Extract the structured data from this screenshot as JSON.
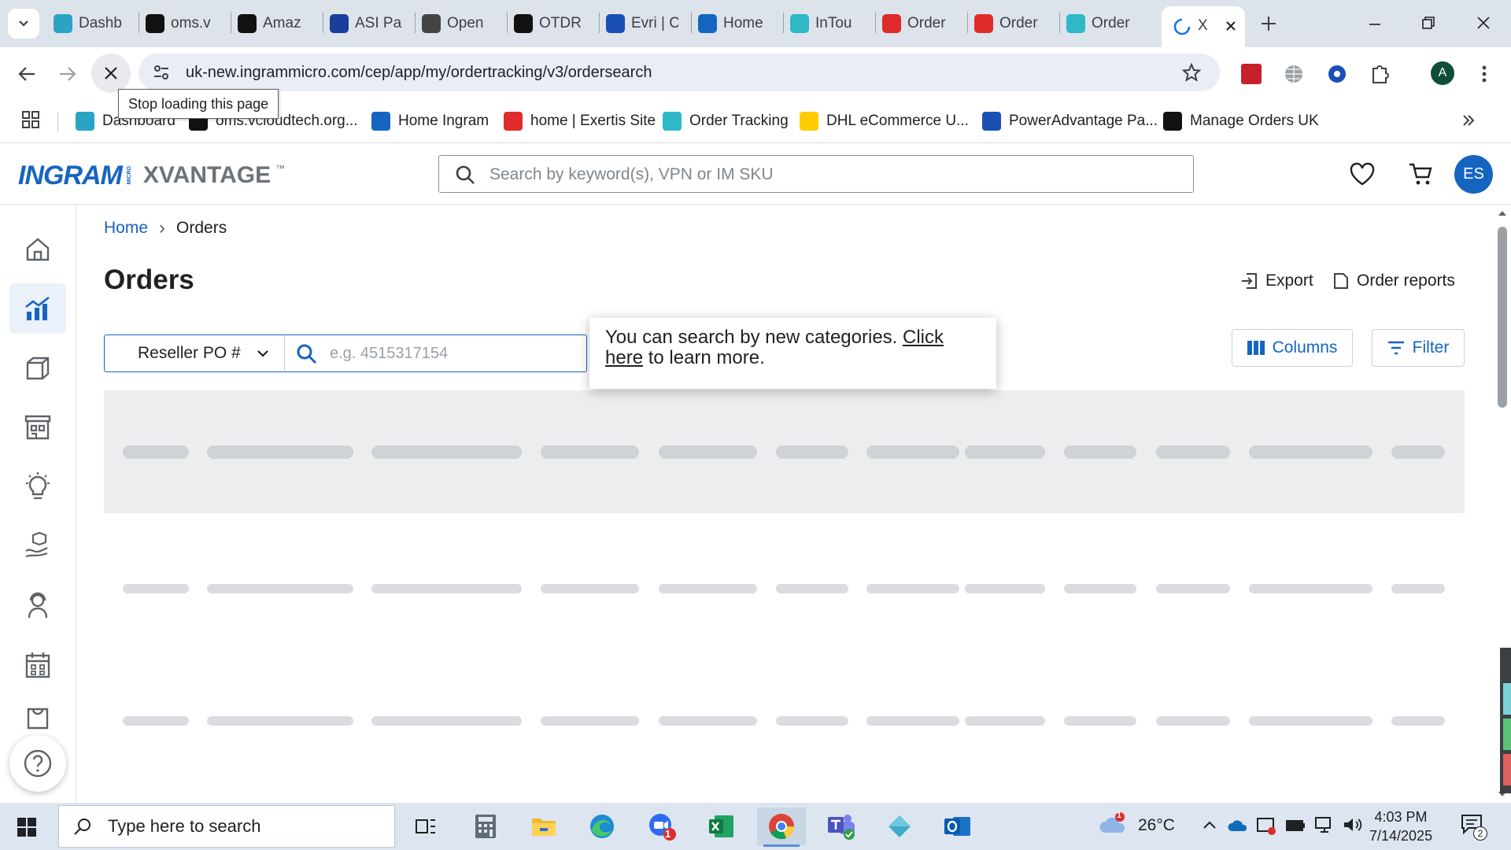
{
  "browser": {
    "tabs": [
      {
        "label": "Dashb",
        "icon": "ingram-tab-icon",
        "color": "#2aa3c4"
      },
      {
        "label": "oms.v",
        "icon": "oms-tab-icon",
        "color": "#111111"
      },
      {
        "label": "Amaz",
        "icon": "amazon-tab-icon",
        "color": "#111111"
      },
      {
        "label": "ASI Pa",
        "icon": "asi-tab-icon",
        "color": "#1a3d9c"
      },
      {
        "label": "Open",
        "icon": "openai-tab-icon",
        "color": "#444444"
      },
      {
        "label": "OTDR",
        "icon": "otdr-tab-icon",
        "color": "#111111"
      },
      {
        "label": "Evri | C",
        "icon": "evri-tab-icon",
        "color": "#1a4fb4"
      },
      {
        "label": "Home",
        "icon": "ingram-home-tab-icon",
        "color": "#1565c0"
      },
      {
        "label": "InTou",
        "icon": "intouch-tab-icon",
        "color": "#2fb8c8"
      },
      {
        "label": "Order",
        "icon": "exertis-tab-icon",
        "color": "#e02b2b"
      },
      {
        "label": "Order",
        "icon": "exertis-tab-icon",
        "color": "#e02b2b"
      },
      {
        "label": "Order",
        "icon": "intouch-tab-icon",
        "color": "#2fb8c8"
      }
    ],
    "active_tab": {
      "label": "X"
    },
    "url": "uk-new.ingrammicro.com/cep/app/my/ordertracking/v3/ordersearch",
    "profile_initial": "A",
    "tooltip": "Stop loading this page",
    "bookmarks": [
      {
        "label": "Dashboard",
        "color": "#2aa3c4"
      },
      {
        "label": "oms.vcloudtech.org...",
        "color": "#111111"
      },
      {
        "label": "Home Ingram",
        "color": "#1565c0"
      },
      {
        "label": "home | Exertis Site",
        "color": "#e02b2b"
      },
      {
        "label": "Order Tracking",
        "color": "#2fb8c8"
      },
      {
        "label": "DHL eCommerce U...",
        "color": "#ffcc00"
      },
      {
        "label": "PowerAdvantage Pa...",
        "color": "#1a4fb4"
      },
      {
        "label": "Manage Orders UK",
        "color": "#111111"
      }
    ]
  },
  "site": {
    "logo_ingram": "INGRAM",
    "logo_micro": "MICRO",
    "logo_xvantage": "XVANTAGE",
    "logo_tm": "™",
    "search_placeholder": "Search by keyword(s), VPN or IM SKU",
    "user_initials": "ES",
    "accent": "#1565c0"
  },
  "breadcrumb": {
    "home": "Home",
    "separator": "›",
    "current": "Orders"
  },
  "page": {
    "title": "Orders",
    "export_label": "Export",
    "reports_label": "Order reports",
    "columns_label": "Columns",
    "filter_label": "Filter",
    "search_category": "Reseller PO #",
    "search_placeholder": "e.g. 4515317154",
    "popover_text": "You can search by new categories. ",
    "popover_link": "Click here",
    "popover_after": " to learn more."
  },
  "taskbar": {
    "search_placeholder": "Type here to search",
    "weather": "26°C",
    "weather_badge": "1",
    "zoom_badge": "1",
    "time": "4:03 PM",
    "date": "7/14/2025",
    "notification_count": "2"
  }
}
